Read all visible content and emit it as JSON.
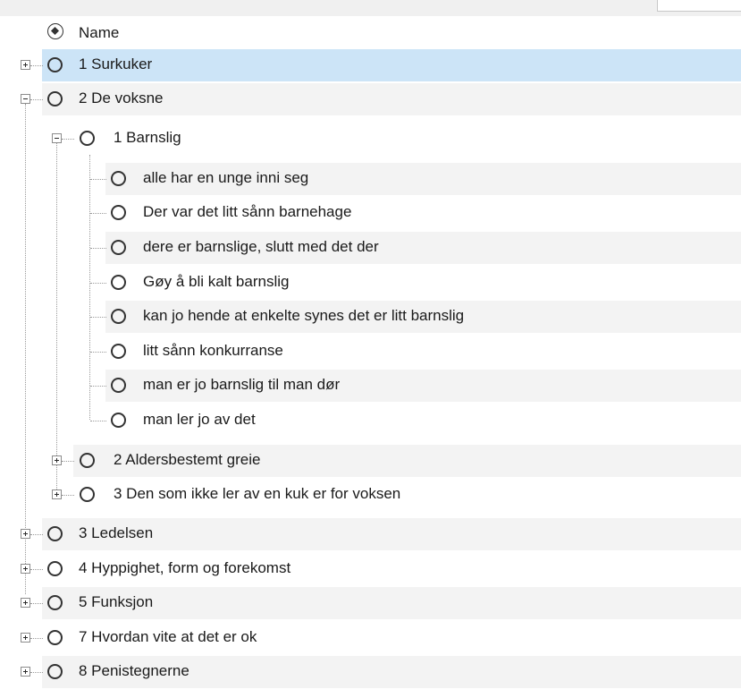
{
  "header": {
    "column_label": "Name",
    "sort_icon": "sort-toggle-icon"
  },
  "colors": {
    "selected_row": "#cce4f7",
    "alt_row": "#f3f3f3",
    "text": "#1a1a1a"
  },
  "nodes": [
    {
      "label": "1 Surkuker",
      "expander": "plus",
      "selected": true
    },
    {
      "label": "2 De voksne",
      "expander": "minus"
    },
    {
      "label": "1 Barnslig",
      "expander": "minus"
    },
    {
      "label": "alle har en unge inni seg"
    },
    {
      "label": "Der var det litt sånn barnehage"
    },
    {
      "label": "dere er barnslige, slutt med det der"
    },
    {
      "label": "Gøy å bli kalt barnslig"
    },
    {
      "label": "kan jo hende at enkelte synes det er litt barnslig"
    },
    {
      "label": "litt sånn konkurranse"
    },
    {
      "label": "man er jo barnslig til man dør"
    },
    {
      "label": "man ler jo av det"
    },
    {
      "label": "2 Aldersbestemt greie",
      "expander": "plus"
    },
    {
      "label": "3 Den som ikke ler av en kuk er for voksen",
      "expander": "plus"
    },
    {
      "label": "3 Ledelsen",
      "expander": "plus"
    },
    {
      "label": "4 Hyppighet, form og forekomst",
      "expander": "plus"
    },
    {
      "label": "5 Funksjon",
      "expander": "plus"
    },
    {
      "label": "7 Hvordan vite at det er ok",
      "expander": "plus"
    },
    {
      "label": "8 Penistegnerne",
      "expander": "plus"
    }
  ]
}
